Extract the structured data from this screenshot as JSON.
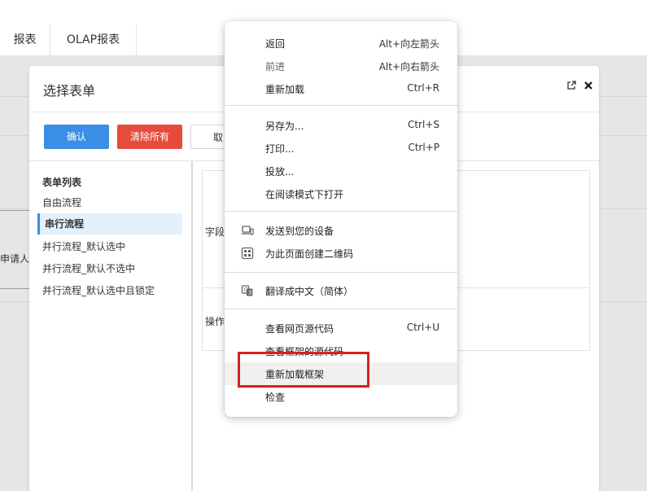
{
  "nav": {
    "tabs": [
      {
        "label": "报表"
      },
      {
        "label": "OLAP报表"
      }
    ]
  },
  "background": {
    "applicant_label": "申请人"
  },
  "modal": {
    "title": "选择表单",
    "buttons": {
      "confirm": "确认",
      "clear_all": "清除所有",
      "cancel": "取"
    },
    "list": {
      "title": "表单列表",
      "items": [
        {
          "label": "自由流程"
        },
        {
          "label": "串行流程"
        },
        {
          "label": "并行流程_默认选中"
        },
        {
          "label": "并行流程_默认不选中"
        },
        {
          "label": "并行流程_默认选中且锁定"
        }
      ],
      "selected_index": 1
    },
    "detail": {
      "field_label": "字段",
      "action_label": "操作"
    }
  },
  "context_menu": {
    "groups": [
      [
        {
          "label": "返回",
          "shortcut": "Alt+向左箭头"
        },
        {
          "label": "前进",
          "shortcut": "Alt+向右箭头",
          "disabled": true
        },
        {
          "label": "重新加载",
          "shortcut": "Ctrl+R"
        }
      ],
      [
        {
          "label": "另存为...",
          "shortcut": "Ctrl+S"
        },
        {
          "label": "打印...",
          "shortcut": "Ctrl+P"
        },
        {
          "label": "投放..."
        },
        {
          "label": "在阅读模式下打开"
        }
      ],
      [
        {
          "label": "发送到您的设备",
          "icon": "devices-icon"
        },
        {
          "label": "为此页面创建二维码",
          "icon": "qr-code-icon"
        }
      ],
      [
        {
          "label": "翻译成中文（简体）",
          "icon": "translate-icon"
        }
      ],
      [
        {
          "label": "查看网页源代码",
          "shortcut": "Ctrl+U"
        },
        {
          "label": "查看框架的源代码"
        },
        {
          "label": "重新加载框架",
          "highlighted": true
        },
        {
          "label": "检查"
        }
      ]
    ]
  },
  "colors": {
    "primary": "#3a8ee6",
    "danger": "#e64c3c",
    "highlight": "#d92020"
  }
}
